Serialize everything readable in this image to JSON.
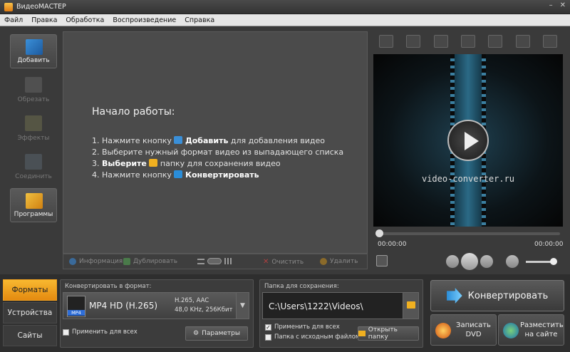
{
  "window": {
    "title": "ВидеоМАСТЕР"
  },
  "menu": [
    "Файл",
    "Правка",
    "Обработка",
    "Воспроизведение",
    "Справка"
  ],
  "sidebar": {
    "items": [
      {
        "label": "Добавить",
        "enabled": true
      },
      {
        "label": "Обрезать",
        "enabled": false
      },
      {
        "label": "Эффекты",
        "enabled": false
      },
      {
        "label": "Соединить",
        "enabled": false
      },
      {
        "label": "Программы",
        "enabled": true
      }
    ]
  },
  "start": {
    "title": "Начало работы:",
    "step1": {
      "pre": "1. Нажмите кнопку ",
      "bold": "Добавить",
      "post": " для добавления видео"
    },
    "step2": "2. Выберите нужный формат видео из выпадающего списка",
    "step3": {
      "bold": "Выберите",
      "post": " папку для сохранения видео",
      "pre": "3. "
    },
    "step4": {
      "pre": "4. Нажмите кнопку ",
      "bold": "Конвертировать"
    }
  },
  "listbar": {
    "info": "Информация",
    "duplicate": "Дублировать",
    "clear": "Очистить",
    "delete": "Удалить"
  },
  "player": {
    "url": "video-converter.ru",
    "time_current": "00:00:00",
    "time_total": "00:00:00",
    "progress": 0,
    "volume": 0.85
  },
  "tabs": [
    "Форматы",
    "Устройства",
    "Сайты"
  ],
  "format": {
    "label": "Конвертировать в формат:",
    "icon_text": "MP4",
    "name": "MP4 HD (H.265)",
    "detail1": "H.265, AAC",
    "detail2": "48,0 KHz, 256Кбит",
    "apply_all": "Применить для всех",
    "params": "Параметры"
  },
  "save": {
    "label": "Папка для сохранения:",
    "path": "C:\\Users\\1222\\Videos\\",
    "apply_all": "Применить для всех",
    "apply_all_checked": true,
    "source_folder": "Папка с исходным файлом",
    "open_folder": "Открыть папку"
  },
  "actions": {
    "convert": "Конвертировать",
    "dvd": "Записать DVD",
    "web": "Разместить на сайте"
  },
  "colors": {
    "accent": "#f0a020",
    "link_blue": "#2a8dd8"
  }
}
